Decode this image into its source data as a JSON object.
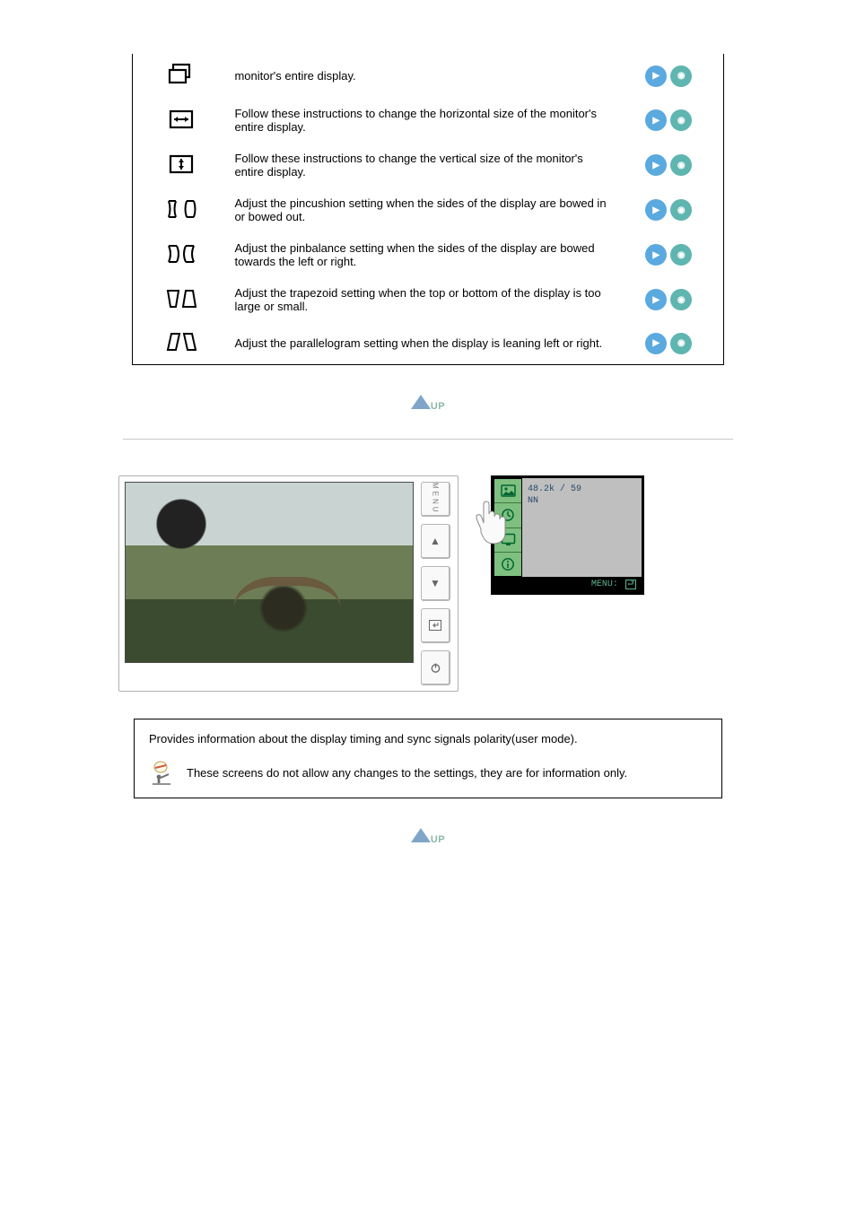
{
  "settings": [
    {
      "icon": "position-icon",
      "desc": "monitor's entire display."
    },
    {
      "icon": "hsize-icon",
      "desc": "Follow these instructions to change the horizontal size of the monitor's entire display."
    },
    {
      "icon": "vsize-icon",
      "desc": "Follow these instructions to change the vertical size of the monitor's entire display."
    },
    {
      "icon": "pincushion-icon",
      "desc": "Adjust the pincushion setting when the sides of the display are bowed in or bowed out."
    },
    {
      "icon": "pinbalance-icon",
      "desc": "Adjust the pinbalance setting when the sides of the display are bowed towards the left or right."
    },
    {
      "icon": "trapezoid-icon",
      "desc": "Adjust the trapezoid setting when the top or bottom of the display is too large or small."
    },
    {
      "icon": "parallelogram-icon",
      "desc": "Adjust the parallelogram setting when the display is leaning left or right."
    }
  ],
  "up_label": "UP",
  "controls": {
    "menu": "MENU",
    "up": "▲",
    "down": "▼",
    "enter": "↵",
    "power": "⏻"
  },
  "osd": {
    "line1": "48.2k / 59",
    "line2": "NN",
    "footer_prefix": "MENU:",
    "footer_icon": "↩"
  },
  "info": {
    "line1": "Provides information about the display timing and sync signals polarity(user mode).",
    "line2": "These screens do not allow any changes to the settings, they are for information only."
  }
}
